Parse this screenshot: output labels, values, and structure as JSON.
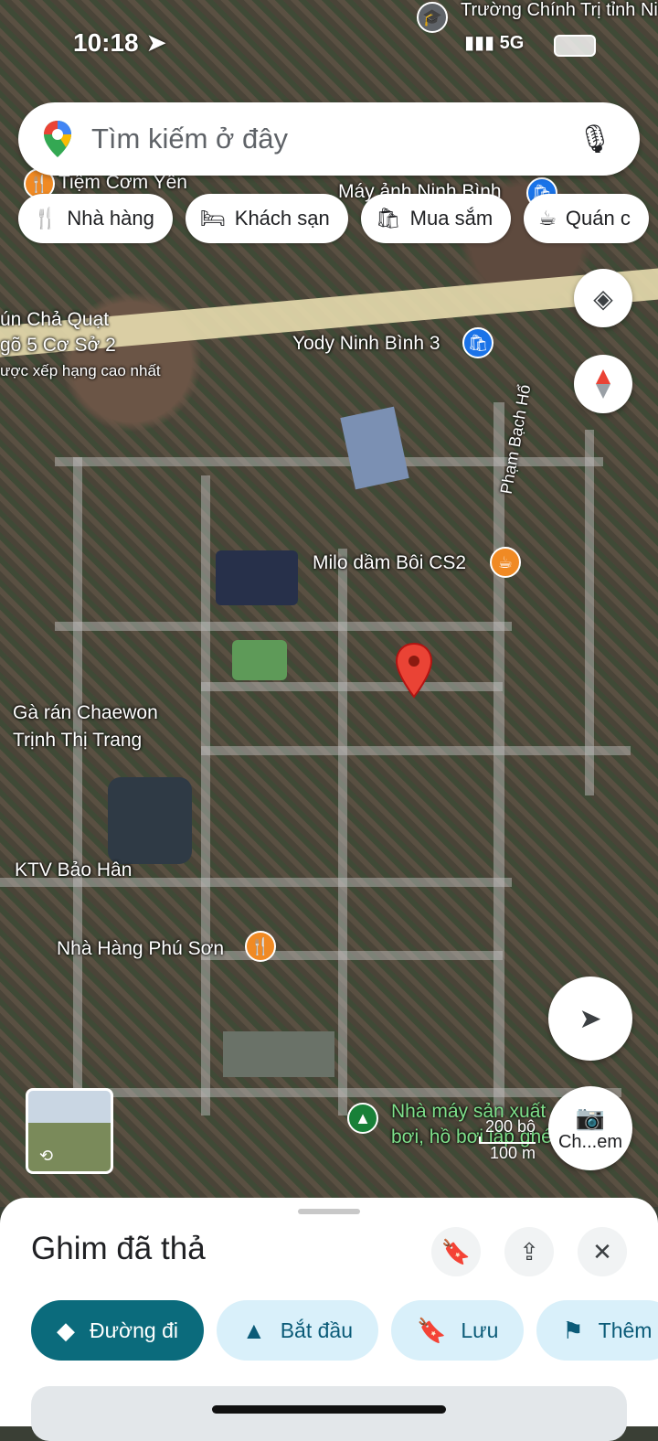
{
  "status_bar": {
    "time": "10:18",
    "network": "5G"
  },
  "search": {
    "placeholder": "Tìm kiếm ở đây"
  },
  "chips": [
    {
      "label": "Nhà hàng",
      "icon": "restaurant-icon"
    },
    {
      "label": "Khách sạn",
      "icon": "hotel-icon"
    },
    {
      "label": "Mua sắm",
      "icon": "shopping-icon"
    },
    {
      "label": "Quán c",
      "icon": "coffee-icon"
    }
  ],
  "map_labels": {
    "top_school": "Trường Chính Trị tỉnh Ninh Bình",
    "tiem_com": "Tiệm Cơm Yên",
    "may_anh": "Máy ảnh Ninh Bình",
    "bun_cha_1": "ún Chả Quạt",
    "bun_cha_2": "gõ 5 Cơ Sở 2",
    "bun_cha_3": "ược xếp hạng cao nhất",
    "yody": "Yody Ninh Bình 3",
    "pham_bach_ho": "Phạm Bạch Hổ",
    "milo": "Milo dầm Bôi CS2",
    "ga_ran_1": "Gà rán Chaewon",
    "ga_ran_2": "Trịnh Thị Trang",
    "ktv": "KTV Bảo Hân",
    "nha_hang_phu_son": "Nhà Hàng Phú Sơn",
    "nha_may_1": "Nhà máy sản xuất",
    "nha_may_2": "bơi, hồ bơi lắp ghép"
  },
  "scale": {
    "feet": "200 bộ",
    "meters": "100 m"
  },
  "camera_button": {
    "label": "Ch...em"
  },
  "sheet": {
    "title": "Ghim đã thả",
    "actions": [
      {
        "label": "Đường đi",
        "icon": "directions-icon",
        "primary": true
      },
      {
        "label": "Bắt đầu",
        "icon": "navigation-icon"
      },
      {
        "label": "Lưu",
        "icon": "bookmark-icon"
      },
      {
        "label": "Thêm",
        "icon": "flag-icon"
      }
    ]
  },
  "colors": {
    "accent": "#0b6b7c",
    "pin": "#ea4335",
    "poi_orange": "#f08a24",
    "poi_blue": "#1a73e8",
    "poi_green": "#188038"
  }
}
